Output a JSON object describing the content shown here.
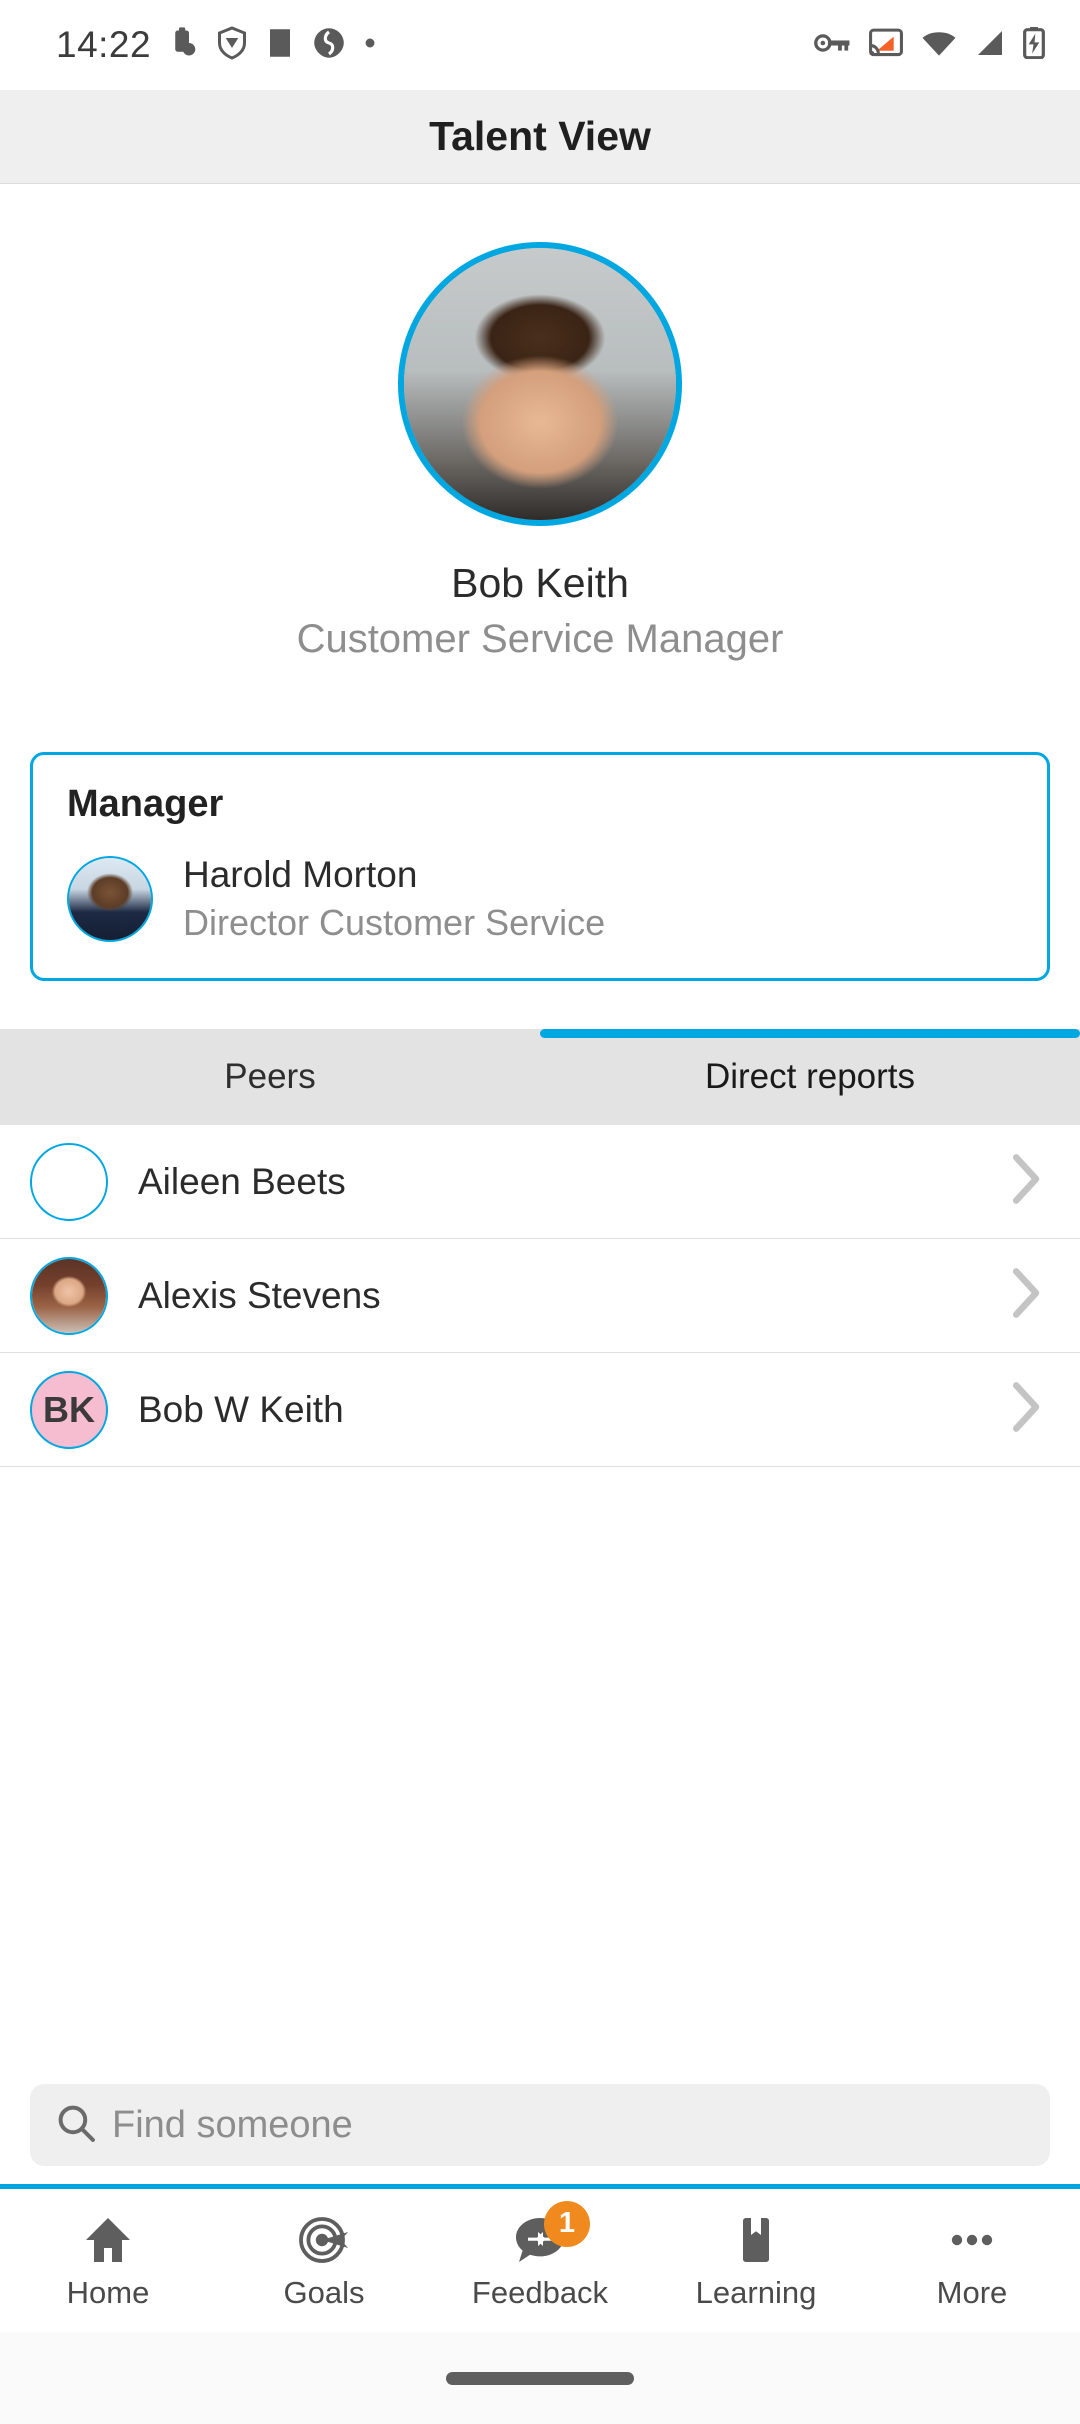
{
  "statusbar": {
    "time": "14:22",
    "left_icons": [
      "clipboard-icon",
      "shield-icon",
      "square-icon",
      "sync-icon",
      "dot-icon"
    ],
    "right_icons": [
      "vpn-key-icon",
      "cast-icon",
      "wifi-icon",
      "cellular-signal-icon",
      "battery-charging-icon"
    ],
    "cast_color": "#f4622a"
  },
  "header": {
    "title": "Talent View"
  },
  "profile": {
    "name": "Bob Keith",
    "title": "Customer Service Manager",
    "avatar_name": "profile-photo-bob-keith",
    "ring_color": "#00a7e1"
  },
  "manager_card": {
    "heading": "Manager",
    "name": "Harold Morton",
    "role": "Director Customer Service",
    "avatar_name": "manager-photo-harold-morton",
    "border_color": "#00a7e1"
  },
  "tabs": {
    "items": [
      {
        "label": "Peers",
        "active": false
      },
      {
        "label": "Direct reports",
        "active": true
      }
    ],
    "indicator_color": "#00a7e1",
    "background": "#e3e3e3"
  },
  "people_list": [
    {
      "name": "Aileen Beets",
      "avatar_type": "photo",
      "photo_class": "ph-aileen",
      "initials": ""
    },
    {
      "name": "Alexis Stevens",
      "avatar_type": "photo",
      "photo_class": "ph-alexis",
      "initials": ""
    },
    {
      "name": "Bob W Keith",
      "avatar_type": "initials",
      "photo_class": "",
      "initials": "BK",
      "initials_bg": "#f6bccf"
    }
  ],
  "search": {
    "placeholder": "Find someone",
    "icon": "search-icon"
  },
  "bottom_nav": {
    "accent": "#00a7e1",
    "badge_color": "#f08a1e",
    "items": [
      {
        "label": "Home",
        "icon": "home-icon",
        "badge": ""
      },
      {
        "label": "Goals",
        "icon": "target-icon",
        "badge": ""
      },
      {
        "label": "Feedback",
        "icon": "feedback-bubble-icon",
        "badge": "1"
      },
      {
        "label": "Learning",
        "icon": "bookmark-icon",
        "badge": ""
      },
      {
        "label": "More",
        "icon": "more-dots-icon",
        "badge": ""
      }
    ]
  }
}
